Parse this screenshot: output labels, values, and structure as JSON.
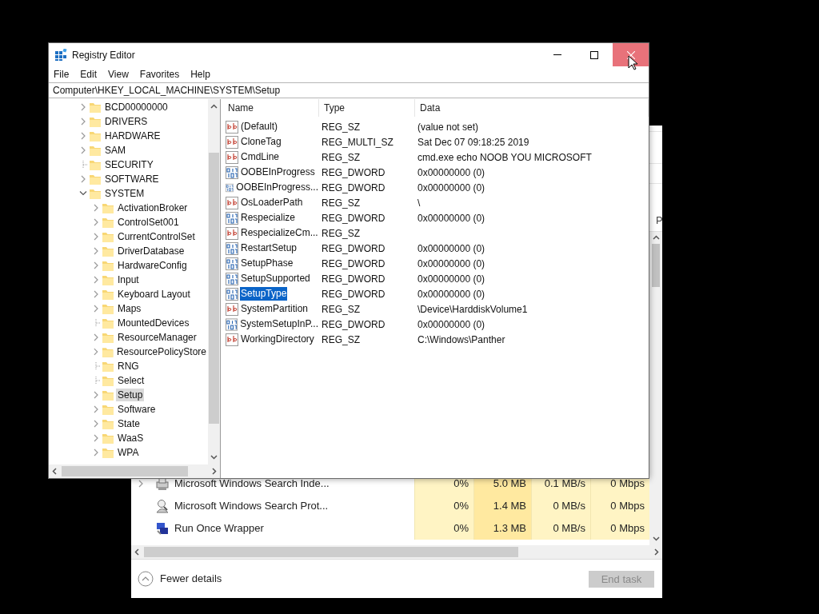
{
  "task_manager": {
    "header_fragment": "P",
    "rows": [
      {
        "name": "Microsoft Windows Search Inde...",
        "cpu": "0%",
        "memory": "5.0 MB",
        "disk": "0.1 MB/s",
        "network": "0 Mbps",
        "kind": "indexer",
        "expandable": true
      },
      {
        "name": "Microsoft Windows Search Prot...",
        "cpu": "0%",
        "memory": "1.4 MB",
        "disk": "0 MB/s",
        "network": "0 Mbps",
        "kind": "protocol",
        "expandable": false
      },
      {
        "name": "Run Once Wrapper",
        "cpu": "0%",
        "memory": "1.3 MB",
        "disk": "0 MB/s",
        "network": "0 Mbps",
        "kind": "wrapper",
        "expandable": false
      }
    ],
    "fewer_details": "Fewer details",
    "end_task": {
      "label": "End task",
      "disabled": true
    }
  },
  "window": {
    "title": "Registry Editor",
    "close_hovered": true
  },
  "menu": [
    "File",
    "Edit",
    "View",
    "Favorites",
    "Help"
  ],
  "address": "Computer\\HKEY_LOCAL_MACHINE\\SYSTEM\\Setup",
  "tree": [
    {
      "label": "BCD00000000",
      "kind": "branch",
      "expanded": false,
      "selected": false
    },
    {
      "label": "DRIVERS",
      "kind": "branch",
      "expanded": false,
      "selected": false
    },
    {
      "label": "HARDWARE",
      "kind": "branch",
      "expanded": false,
      "selected": false
    },
    {
      "label": "SAM",
      "kind": "branch",
      "expanded": false,
      "selected": false
    },
    {
      "label": "SECURITY",
      "kind": "leaf",
      "selected": false
    },
    {
      "label": "SOFTWARE",
      "kind": "branch",
      "expanded": false,
      "selected": false
    },
    {
      "label": "SYSTEM",
      "kind": "branch",
      "expanded": true,
      "selected": false,
      "children": [
        {
          "label": "ActivationBroker",
          "kind": "branch",
          "expanded": false,
          "selected": false
        },
        {
          "label": "ControlSet001",
          "kind": "branch",
          "expanded": false,
          "selected": false
        },
        {
          "label": "CurrentControlSet",
          "kind": "branch",
          "expanded": false,
          "selected": false
        },
        {
          "label": "DriverDatabase",
          "kind": "branch",
          "expanded": false,
          "selected": false
        },
        {
          "label": "HardwareConfig",
          "kind": "branch",
          "expanded": false,
          "selected": false
        },
        {
          "label": "Input",
          "kind": "branch",
          "expanded": false,
          "selected": false
        },
        {
          "label": "Keyboard Layout",
          "kind": "branch",
          "expanded": false,
          "selected": false
        },
        {
          "label": "Maps",
          "kind": "branch",
          "expanded": false,
          "selected": false
        },
        {
          "label": "MountedDevices",
          "kind": "leaf",
          "selected": false
        },
        {
          "label": "ResourceManager",
          "kind": "branch",
          "expanded": false,
          "selected": false
        },
        {
          "label": "ResourcePolicyStore",
          "kind": "branch",
          "expanded": false,
          "selected": false
        },
        {
          "label": "RNG",
          "kind": "leaf",
          "selected": false
        },
        {
          "label": "Select",
          "kind": "leaf",
          "selected": false
        },
        {
          "label": "Setup",
          "kind": "branch",
          "expanded": false,
          "selected": true
        },
        {
          "label": "Software",
          "kind": "branch",
          "expanded": false,
          "selected": false
        },
        {
          "label": "State",
          "kind": "branch",
          "expanded": false,
          "selected": false
        },
        {
          "label": "WaaS",
          "kind": "branch",
          "expanded": false,
          "selected": false
        },
        {
          "label": "WPA",
          "kind": "branch",
          "expanded": false,
          "selected": false
        }
      ]
    }
  ],
  "values": {
    "columns": [
      "Name",
      "Type",
      "Data"
    ],
    "rows": [
      {
        "name": "(Default)",
        "type": "REG_SZ",
        "data": "(value not set)",
        "kind": "string",
        "selected": false
      },
      {
        "name": "CloneTag",
        "type": "REG_MULTI_SZ",
        "data": "Sat Dec 07 09:18:25 2019",
        "kind": "string",
        "selected": false
      },
      {
        "name": "CmdLine",
        "type": "REG_SZ",
        "data": "cmd.exe echo NOOB YOU MICROSOFT",
        "kind": "string",
        "selected": false
      },
      {
        "name": "OOBEInProgress",
        "type": "REG_DWORD",
        "data": "0x00000000 (0)",
        "kind": "binary",
        "selected": false
      },
      {
        "name": "OOBEInProgress...",
        "type": "REG_DWORD",
        "data": "0x00000000 (0)",
        "kind": "binary",
        "selected": false
      },
      {
        "name": "OsLoaderPath",
        "type": "REG_SZ",
        "data": "\\",
        "kind": "string",
        "selected": false
      },
      {
        "name": "Respecialize",
        "type": "REG_DWORD",
        "data": "0x00000000 (0)",
        "kind": "binary",
        "selected": false
      },
      {
        "name": "RespecializeCm...",
        "type": "REG_SZ",
        "kind": "string",
        "selected": false
      },
      {
        "name": "RestartSetup",
        "type": "REG_DWORD",
        "data": "0x00000000 (0)",
        "kind": "binary",
        "selected": false
      },
      {
        "name": "SetupPhase",
        "type": "REG_DWORD",
        "data": "0x00000000 (0)",
        "kind": "binary",
        "selected": false
      },
      {
        "name": "SetupSupported",
        "type": "REG_DWORD",
        "data": "0x00000000 (0)",
        "kind": "binary",
        "selected": false
      },
      {
        "name": "SetupType",
        "type": "REG_DWORD",
        "data": "0x00000000 (0)",
        "kind": "binary",
        "selected": true
      },
      {
        "name": "SystemPartition",
        "type": "REG_SZ",
        "data": "\\Device\\HarddiskVolume1",
        "kind": "string",
        "selected": false
      },
      {
        "name": "SystemSetupInP...",
        "type": "REG_DWORD",
        "data": "0x00000000 (0)",
        "kind": "binary",
        "selected": false
      },
      {
        "name": "WorkingDirectory",
        "type": "REG_SZ",
        "data": "C:\\Windows\\Panther",
        "kind": "string",
        "selected": false
      }
    ]
  }
}
